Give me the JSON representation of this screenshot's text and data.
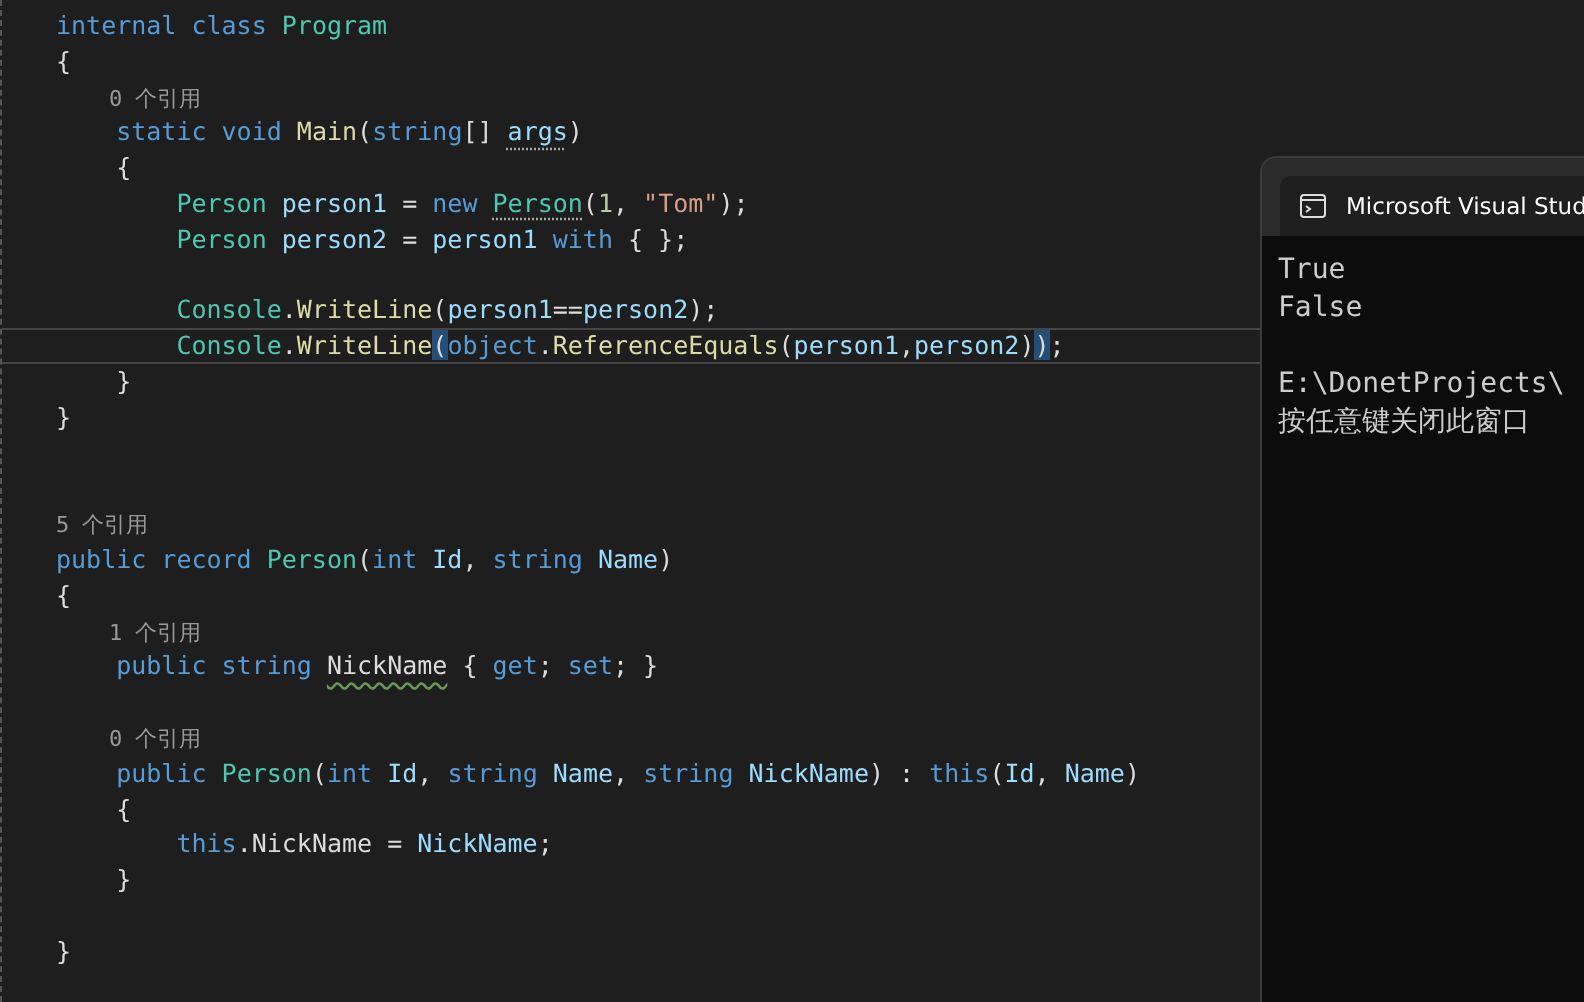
{
  "editor": {
    "lines": [
      {
        "kind": "code",
        "current": false,
        "tokens": [
          {
            "kind": "kw",
            "s": "internal class "
          },
          {
            "kind": "type",
            "s": "Program"
          }
        ]
      },
      {
        "kind": "code",
        "current": false,
        "tokens": [
          {
            "kind": "plain",
            "s": "{"
          }
        ]
      },
      {
        "kind": "lens",
        "current": false,
        "tokens": [
          {
            "kind": "lens",
            "s": "    0 个引用"
          }
        ]
      },
      {
        "kind": "code",
        "current": false,
        "tokens": [
          {
            "kind": "kw",
            "s": "    static void "
          },
          {
            "kind": "method",
            "s": "Main"
          },
          {
            "kind": "plain",
            "s": "("
          },
          {
            "kind": "kw",
            "s": "string"
          },
          {
            "kind": "plain",
            "s": "[] "
          },
          {
            "kind": "var",
            "s": "args",
            "dotted": true
          },
          {
            "kind": "plain",
            "s": ")"
          }
        ]
      },
      {
        "kind": "code",
        "current": false,
        "tokens": [
          {
            "kind": "plain",
            "s": "    {"
          }
        ]
      },
      {
        "kind": "code",
        "current": false,
        "tokens": [
          {
            "kind": "type",
            "s": "        Person "
          },
          {
            "kind": "var",
            "s": "person1"
          },
          {
            "kind": "plain",
            "s": " = "
          },
          {
            "kind": "kw",
            "s": "new "
          },
          {
            "kind": "type",
            "s": "Person",
            "dotted": true
          },
          {
            "kind": "plain",
            "s": "("
          },
          {
            "kind": "num",
            "s": "1"
          },
          {
            "kind": "plain",
            "s": ", "
          },
          {
            "kind": "str",
            "s": "\"Tom\""
          },
          {
            "kind": "plain",
            "s": ");"
          }
        ]
      },
      {
        "kind": "code",
        "current": false,
        "tokens": [
          {
            "kind": "type",
            "s": "        Person "
          },
          {
            "kind": "var",
            "s": "person2"
          },
          {
            "kind": "plain",
            "s": " = "
          },
          {
            "kind": "var",
            "s": "person1"
          },
          {
            "kind": "kw",
            "s": " with "
          },
          {
            "kind": "plain",
            "s": "{ };"
          }
        ]
      },
      {
        "kind": "blank",
        "current": false
      },
      {
        "kind": "code",
        "current": false,
        "tokens": [
          {
            "kind": "type",
            "s": "        Console"
          },
          {
            "kind": "plain",
            "s": "."
          },
          {
            "kind": "method",
            "s": "WriteLine"
          },
          {
            "kind": "plain",
            "s": "("
          },
          {
            "kind": "var",
            "s": "person1"
          },
          {
            "kind": "plain",
            "s": "=="
          },
          {
            "kind": "var",
            "s": "person2"
          },
          {
            "kind": "plain",
            "s": ");"
          }
        ]
      },
      {
        "kind": "code",
        "current": true,
        "tokens": [
          {
            "kind": "type",
            "s": "        Console"
          },
          {
            "kind": "plain",
            "s": "."
          },
          {
            "kind": "method",
            "s": "WriteLine"
          },
          {
            "kind": "plain",
            "s": "(",
            "matched": true
          },
          {
            "kind": "kw",
            "s": "object"
          },
          {
            "kind": "plain",
            "s": "."
          },
          {
            "kind": "method",
            "s": "ReferenceEquals"
          },
          {
            "kind": "plain",
            "s": "("
          },
          {
            "kind": "var",
            "s": "person1"
          },
          {
            "kind": "plain",
            "s": ","
          },
          {
            "kind": "var",
            "s": "person2"
          },
          {
            "kind": "plain",
            "s": ")"
          },
          {
            "kind": "plain",
            "s": ")",
            "matched": true
          },
          {
            "kind": "plain",
            "s": ";"
          }
        ]
      },
      {
        "kind": "code",
        "current": false,
        "tokens": [
          {
            "kind": "plain",
            "s": "    }"
          }
        ]
      },
      {
        "kind": "code",
        "current": false,
        "tokens": [
          {
            "kind": "plain",
            "s": "}"
          }
        ]
      },
      {
        "kind": "blank",
        "current": false
      },
      {
        "kind": "blank",
        "current": false
      },
      {
        "kind": "lens",
        "current": false,
        "tokens": [
          {
            "kind": "lens",
            "s": "5 个引用"
          }
        ]
      },
      {
        "kind": "code",
        "current": false,
        "tokens": [
          {
            "kind": "kw",
            "s": "public record "
          },
          {
            "kind": "type",
            "s": "Person"
          },
          {
            "kind": "plain",
            "s": "("
          },
          {
            "kind": "kw",
            "s": "int "
          },
          {
            "kind": "var",
            "s": "Id"
          },
          {
            "kind": "plain",
            "s": ", "
          },
          {
            "kind": "kw",
            "s": "string "
          },
          {
            "kind": "var",
            "s": "Name"
          },
          {
            "kind": "plain",
            "s": ")"
          }
        ]
      },
      {
        "kind": "code",
        "current": false,
        "tokens": [
          {
            "kind": "plain",
            "s": "{"
          }
        ]
      },
      {
        "kind": "lens",
        "current": false,
        "tokens": [
          {
            "kind": "lens",
            "s": "    1 个引用"
          }
        ]
      },
      {
        "kind": "code",
        "current": false,
        "tokens": [
          {
            "kind": "kw",
            "s": "    public string "
          },
          {
            "kind": "plain",
            "s": "NickName",
            "warning": true
          },
          {
            "kind": "plain",
            "s": " { "
          },
          {
            "kind": "kw",
            "s": "get"
          },
          {
            "kind": "plain",
            "s": "; "
          },
          {
            "kind": "kw",
            "s": "set"
          },
          {
            "kind": "plain",
            "s": "; }"
          }
        ]
      },
      {
        "kind": "blank",
        "current": false
      },
      {
        "kind": "lens",
        "current": false,
        "tokens": [
          {
            "kind": "lens",
            "s": "    0 个引用"
          }
        ]
      },
      {
        "kind": "code",
        "current": false,
        "tokens": [
          {
            "kind": "kw",
            "s": "    public "
          },
          {
            "kind": "type",
            "s": "Person"
          },
          {
            "kind": "plain",
            "s": "("
          },
          {
            "kind": "kw",
            "s": "int "
          },
          {
            "kind": "var",
            "s": "Id"
          },
          {
            "kind": "plain",
            "s": ", "
          },
          {
            "kind": "kw",
            "s": "string "
          },
          {
            "kind": "var",
            "s": "Name"
          },
          {
            "kind": "plain",
            "s": ", "
          },
          {
            "kind": "kw",
            "s": "string "
          },
          {
            "kind": "var",
            "s": "NickName"
          },
          {
            "kind": "plain",
            "s": ") : "
          },
          {
            "kind": "kw",
            "s": "this"
          },
          {
            "kind": "plain",
            "s": "("
          },
          {
            "kind": "var",
            "s": "Id"
          },
          {
            "kind": "plain",
            "s": ", "
          },
          {
            "kind": "var",
            "s": "Name"
          },
          {
            "kind": "plain",
            "s": ")"
          }
        ]
      },
      {
        "kind": "code",
        "current": false,
        "tokens": [
          {
            "kind": "plain",
            "s": "    {"
          }
        ]
      },
      {
        "kind": "code",
        "current": false,
        "tokens": [
          {
            "kind": "kw",
            "s": "        this"
          },
          {
            "kind": "plain",
            "s": ".NickName = "
          },
          {
            "kind": "var",
            "s": "NickName"
          },
          {
            "kind": "plain",
            "s": ";"
          }
        ]
      },
      {
        "kind": "code",
        "current": false,
        "tokens": [
          {
            "kind": "plain",
            "s": "    }"
          }
        ]
      },
      {
        "kind": "blank",
        "current": false
      },
      {
        "kind": "code",
        "current": false,
        "tokens": [
          {
            "kind": "plain",
            "s": "}"
          }
        ]
      }
    ]
  },
  "console": {
    "title": "Microsoft Visual Stud",
    "blocks": [
      [
        "True",
        "False"
      ],
      [
        "E:\\DonetProjects\\",
        "按任意键关闭此窗口"
      ]
    ]
  }
}
